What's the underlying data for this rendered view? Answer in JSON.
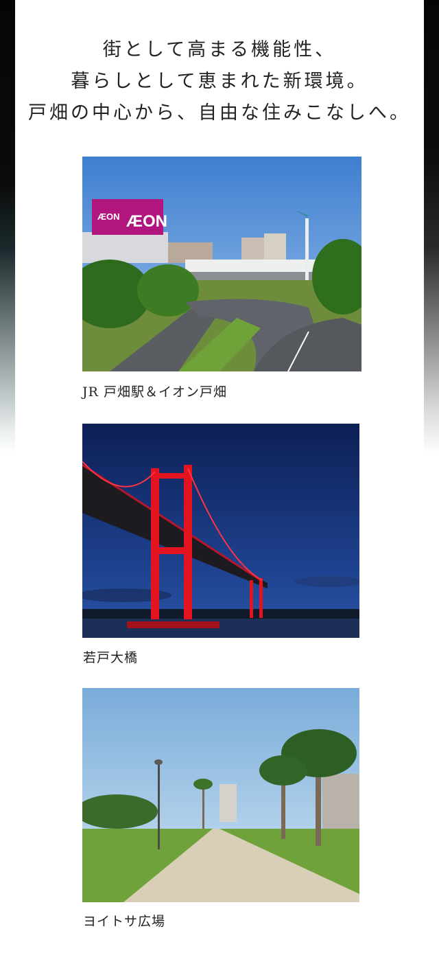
{
  "headline": {
    "line1": "街として高まる機能性、",
    "line2": "暮らしとして恵まれた新環境。",
    "line3": "戸畑の中心から、自由な住みこなしへ。"
  },
  "photos": [
    {
      "caption": "JR 戸畑駅＆イオン戸畑",
      "sign_text": "ÆON"
    },
    {
      "caption": "若戸大橋"
    },
    {
      "caption": "ヨイトサ広場"
    }
  ]
}
